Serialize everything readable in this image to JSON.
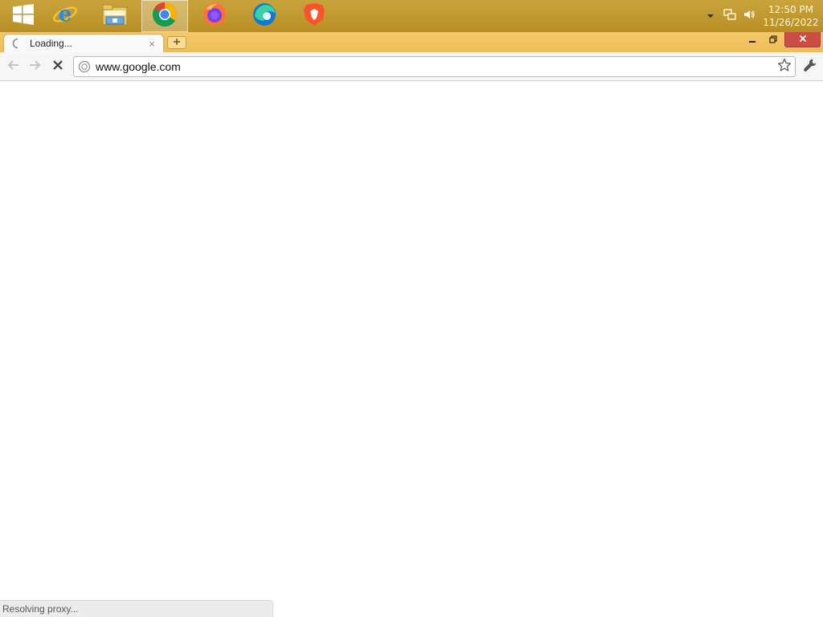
{
  "taskbar": {
    "pinned": [
      {
        "name": "windows-start-icon"
      },
      {
        "name": "internet-explorer-icon"
      },
      {
        "name": "file-explorer-icon"
      },
      {
        "name": "chrome-icon",
        "active": true
      },
      {
        "name": "firefox-icon"
      },
      {
        "name": "edge-icon"
      },
      {
        "name": "brave-icon"
      }
    ],
    "tray": {
      "time": "12:50 PM",
      "date": "11/26/2022"
    },
    "colors": {
      "bar": "#c19a33",
      "text": "#fdf6e2"
    }
  },
  "browser": {
    "tab": {
      "title": "Loading...",
      "close_glyph": "×"
    },
    "omnibox": {
      "url": "www.google.com"
    },
    "status": "Resolving proxy...",
    "colors": {
      "frame": "#f1c25f",
      "close": "#c94f45"
    }
  }
}
